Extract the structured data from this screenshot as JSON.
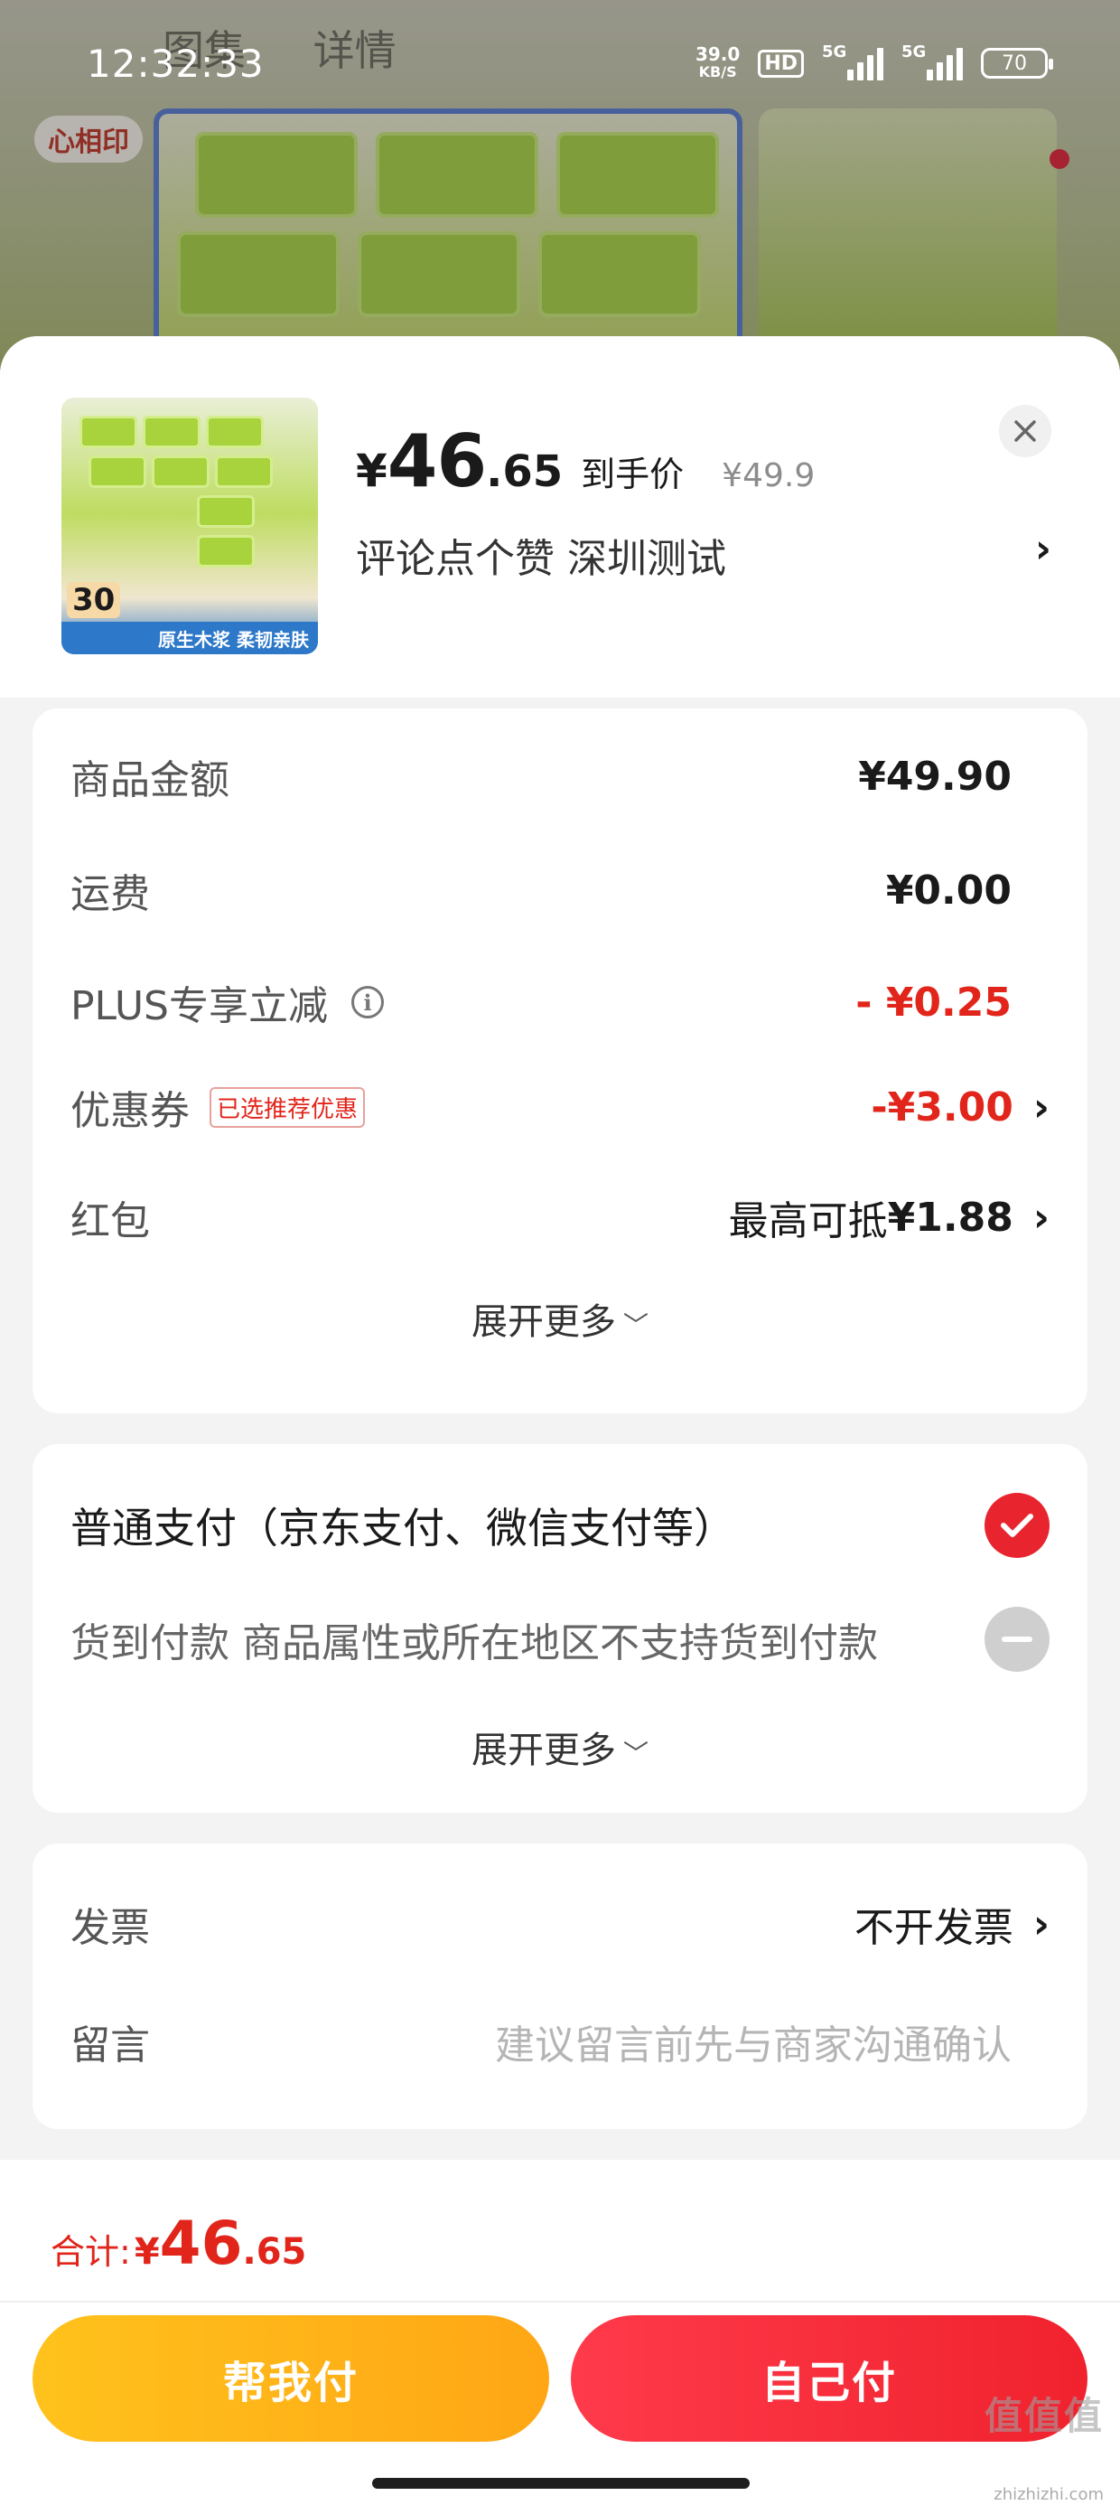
{
  "status_bar": {
    "time": "12:32:33",
    "net_speed_value": "39.0",
    "net_speed_unit": "KB/S",
    "hd_label": "HD",
    "signal1_label": "5G",
    "signal2_label": "5G",
    "battery": "70"
  },
  "background": {
    "tabs": [
      "图集",
      "详情"
    ],
    "logo_text": "心相印"
  },
  "product": {
    "price_symbol": "¥",
    "price_int": "46",
    "price_dec": ".65",
    "price_tag": "到手价",
    "original_price": "¥49.9",
    "spec": "评论点个赞  深圳测试",
    "image_count_badge": "30",
    "image_band_text": "原生木浆 柔韧亲肤"
  },
  "fees": {
    "rows": [
      {
        "label": "商品金额",
        "value": "¥49.90"
      },
      {
        "label": "运费",
        "value": "¥0.00"
      },
      {
        "label": "PLUS专享立减",
        "value": "- ¥0.25"
      },
      {
        "label": "优惠券",
        "tag": "已选推荐优惠",
        "value": "-¥3.00"
      },
      {
        "label": "红包",
        "value_prefix": "最高可抵",
        "value": "¥1.88"
      }
    ],
    "expand_label": "展开更多"
  },
  "payment": {
    "options": [
      {
        "label": "普通支付（京东支付、微信支付等）",
        "selected": true
      },
      {
        "label": "货到付款 商品属性或所在地区不支持货到付款",
        "selected": false
      }
    ],
    "expand_label": "展开更多"
  },
  "invoice": {
    "label": "发票",
    "value": "不开发票",
    "message_label": "留言",
    "message_placeholder": "建议留言前先与商家沟通确认"
  },
  "footer": {
    "total_label": "合计:",
    "total_symbol": "¥",
    "total_int": "46",
    "total_dec": ".65",
    "help_pay": "帮我付",
    "self_pay": "自己付",
    "watermark": "值值值",
    "watermark_sub": "zhizhizhi.com"
  },
  "colors": {
    "accent_red": "#e1251b",
    "button_red": "#f0222e",
    "button_yellow": "#ffb319"
  },
  "icons": [
    "close-icon",
    "chevron-right-icon",
    "info-icon",
    "checkmark-icon",
    "disabled-minus-icon",
    "chevron-down-icon"
  ]
}
